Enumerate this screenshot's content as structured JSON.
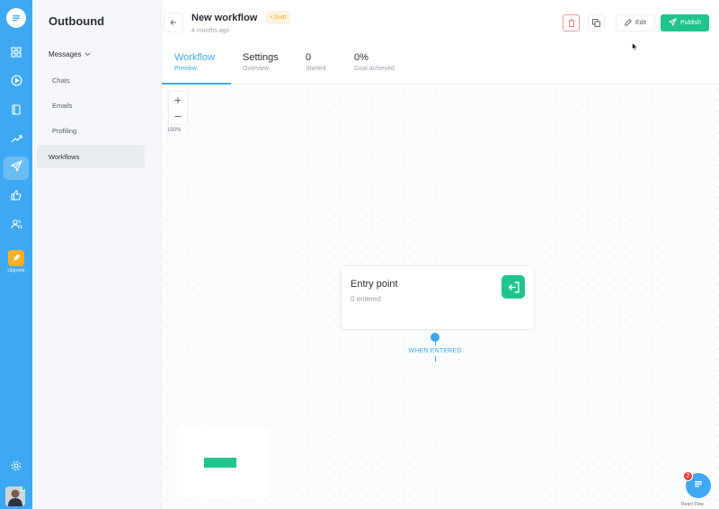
{
  "rail": {
    "items": [
      {
        "name": "rail-item-dashboard",
        "icon": "grid-icon"
      },
      {
        "name": "rail-item-play",
        "icon": "play-circle-icon"
      },
      {
        "name": "rail-item-book",
        "icon": "book-icon"
      },
      {
        "name": "rail-item-reports",
        "icon": "trending-up-icon"
      },
      {
        "name": "rail-item-outbound",
        "icon": "paper-plane-icon",
        "active": true
      },
      {
        "name": "rail-item-feedback",
        "icon": "thumbs-up-icon"
      },
      {
        "name": "rail-item-people",
        "icon": "users-icon"
      }
    ],
    "upgrade_label": "Upgrade",
    "settings_icon": "gear-icon"
  },
  "sidebar": {
    "title": "Outbound",
    "group_label": "Messages",
    "items": [
      {
        "label": "Chats"
      },
      {
        "label": "Emails"
      },
      {
        "label": "Profiling"
      }
    ],
    "active_item": "Workflows"
  },
  "header": {
    "title": "New workflow",
    "status_badge": "Draft",
    "age": "4 months ago",
    "edit_label": "Edit",
    "publish_label": "Publish"
  },
  "tabs": [
    {
      "label": "Workflow",
      "sub": "Preview",
      "active": true
    },
    {
      "label": "Settings",
      "sub": "Overview"
    },
    {
      "label": "0",
      "sub": "Started"
    },
    {
      "label": "0%",
      "sub": "Goal achieved"
    }
  ],
  "canvas": {
    "zoom_level": "150%",
    "entry_node": {
      "title": "Entry point",
      "subtitle": "0 entered"
    },
    "edge_label": "WHEN ENTERED",
    "chat_badge_count": "2",
    "attribution": "React Flow"
  },
  "colors": {
    "rail": "#3ea9f2",
    "accent": "#3ea9f2",
    "success": "#1fc58c",
    "draft": "#f5a623",
    "danger": "#e53935"
  }
}
